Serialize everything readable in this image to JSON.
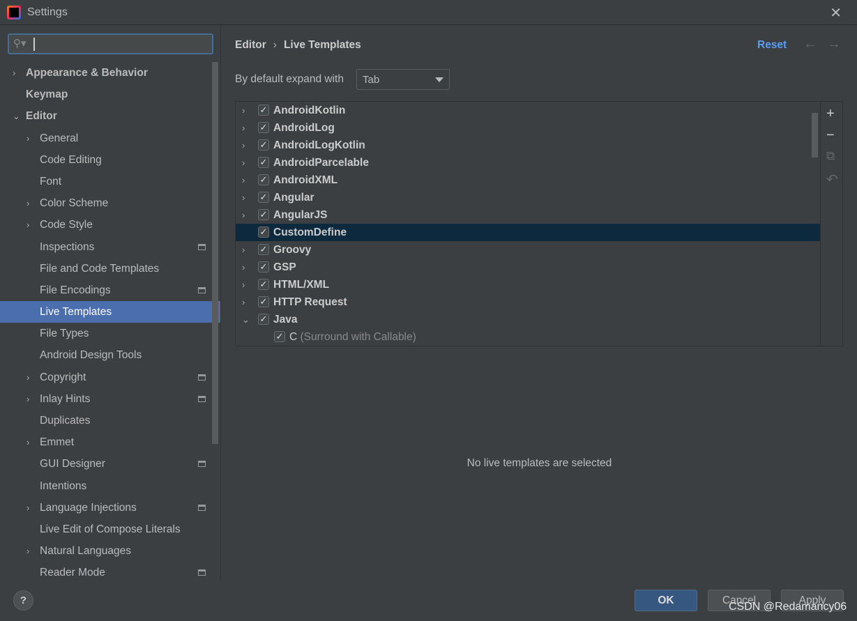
{
  "window": {
    "title": "Settings",
    "close_icon": "close-icon"
  },
  "search": {
    "value": "",
    "placeholder": ""
  },
  "sidebar": {
    "items": [
      {
        "label": "Appearance & Behavior",
        "level": 0,
        "chevron": "right"
      },
      {
        "label": "Keymap",
        "level": 0,
        "chevron": ""
      },
      {
        "label": "Editor",
        "level": 0,
        "chevron": "down"
      },
      {
        "label": "General",
        "level": 1,
        "chevron": "right"
      },
      {
        "label": "Code Editing",
        "level": 1,
        "chevron": ""
      },
      {
        "label": "Font",
        "level": 1,
        "chevron": ""
      },
      {
        "label": "Color Scheme",
        "level": 1,
        "chevron": "right"
      },
      {
        "label": "Code Style",
        "level": 1,
        "chevron": "right"
      },
      {
        "label": "Inspections",
        "level": 1,
        "chevron": "",
        "project_icon": true
      },
      {
        "label": "File and Code Templates",
        "level": 1,
        "chevron": ""
      },
      {
        "label": "File Encodings",
        "level": 1,
        "chevron": "",
        "project_icon": true
      },
      {
        "label": "Live Templates",
        "level": 1,
        "chevron": "",
        "selected": true
      },
      {
        "label": "File Types",
        "level": 1,
        "chevron": ""
      },
      {
        "label": "Android Design Tools",
        "level": 1,
        "chevron": ""
      },
      {
        "label": "Copyright",
        "level": 1,
        "chevron": "right",
        "project_icon": true
      },
      {
        "label": "Inlay Hints",
        "level": 1,
        "chevron": "right",
        "project_icon": true
      },
      {
        "label": "Duplicates",
        "level": 1,
        "chevron": ""
      },
      {
        "label": "Emmet",
        "level": 1,
        "chevron": "right"
      },
      {
        "label": "GUI Designer",
        "level": 1,
        "chevron": "",
        "project_icon": true
      },
      {
        "label": "Intentions",
        "level": 1,
        "chevron": ""
      },
      {
        "label": "Language Injections",
        "level": 1,
        "chevron": "right",
        "project_icon": true
      },
      {
        "label": "Live Edit of Compose Literals",
        "level": 1,
        "chevron": ""
      },
      {
        "label": "Natural Languages",
        "level": 1,
        "chevron": "right"
      },
      {
        "label": "Reader Mode",
        "level": 1,
        "chevron": "",
        "project_icon": true
      }
    ]
  },
  "breadcrumb": {
    "parent": "Editor",
    "separator": "›",
    "current": "Live Templates"
  },
  "header": {
    "reset": "Reset",
    "back": "←",
    "forward": "→"
  },
  "expand": {
    "label": "By default expand with",
    "value": "Tab"
  },
  "templates": [
    {
      "label": "AndroidKotlin",
      "checked": true,
      "chevron": "right"
    },
    {
      "label": "AndroidLog",
      "checked": true,
      "chevron": "right"
    },
    {
      "label": "AndroidLogKotlin",
      "checked": true,
      "chevron": "right"
    },
    {
      "label": "AndroidParcelable",
      "checked": true,
      "chevron": "right"
    },
    {
      "label": "AndroidXML",
      "checked": true,
      "chevron": "right"
    },
    {
      "label": "Angular",
      "checked": true,
      "chevron": "right"
    },
    {
      "label": "AngularJS",
      "checked": true,
      "chevron": "right"
    },
    {
      "label": "CustomDefine",
      "checked": true,
      "chevron": "",
      "selected": true
    },
    {
      "label": "Groovy",
      "checked": true,
      "chevron": "right"
    },
    {
      "label": "GSP",
      "checked": true,
      "chevron": "right"
    },
    {
      "label": "HTML/XML",
      "checked": true,
      "chevron": "right"
    },
    {
      "label": "HTTP Request",
      "checked": true,
      "chevron": "right"
    },
    {
      "label": "Java",
      "checked": true,
      "chevron": "down"
    },
    {
      "label": "C",
      "desc": "(Surround with Callable)",
      "checked": true,
      "child": true
    }
  ],
  "tools": {
    "add": "+",
    "remove": "−",
    "copy": "⧉",
    "restore": "↶"
  },
  "empty_message": "No live templates are selected",
  "footer": {
    "help": "?",
    "ok": "OK",
    "cancel": "Cancel",
    "apply": "Apply"
  },
  "watermark": "CSDN @Redamancy06",
  "colors": {
    "accent": "#4b6eaf",
    "link": "#589df6",
    "ok_button": "#365880",
    "tree_selection": "#0d293e"
  }
}
